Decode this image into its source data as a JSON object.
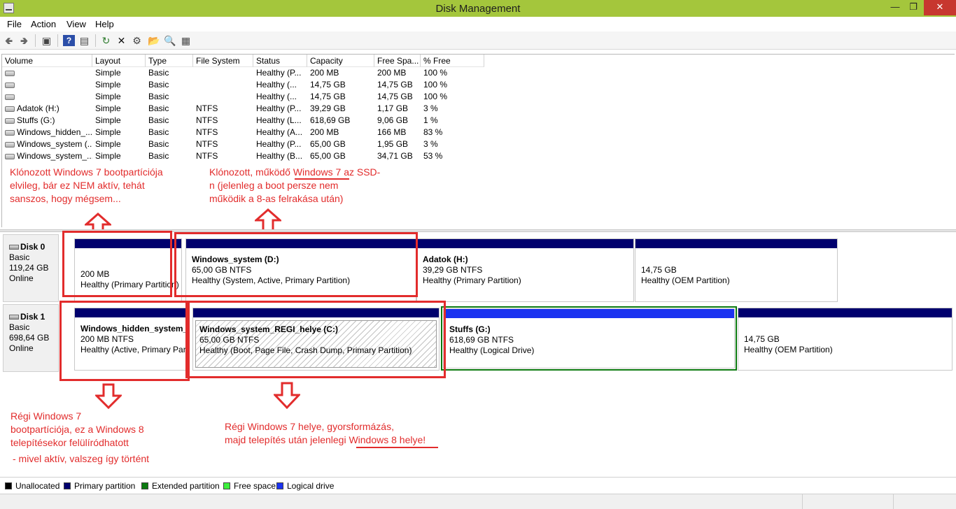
{
  "window": {
    "title": "Disk Management"
  },
  "menu": [
    "File",
    "Action",
    "View",
    "Help"
  ],
  "toolbar": {
    "icons": [
      "back-icon",
      "forward-icon",
      "console-tree-icon",
      "help-icon",
      "properties-icon",
      "refresh-icon",
      "delete-icon",
      "settings-icon",
      "open-icon",
      "search-icon",
      "export-icon"
    ]
  },
  "volume_list": {
    "columns": [
      "Volume",
      "Layout",
      "Type",
      "File System",
      "Status",
      "Capacity",
      "Free Spa...",
      "% Free"
    ],
    "rows": [
      [
        "",
        "Simple",
        "Basic",
        "",
        "Healthy (P...",
        "200 MB",
        "200 MB",
        "100 %"
      ],
      [
        "",
        "Simple",
        "Basic",
        "",
        "Healthy (...",
        "14,75 GB",
        "14,75 GB",
        "100 %"
      ],
      [
        "",
        "Simple",
        "Basic",
        "",
        "Healthy (...",
        "14,75 GB",
        "14,75 GB",
        "100 %"
      ],
      [
        "Adatok (H:)",
        "Simple",
        "Basic",
        "NTFS",
        "Healthy (P...",
        "39,29 GB",
        "1,17 GB",
        "3 %"
      ],
      [
        "Stuffs (G:)",
        "Simple",
        "Basic",
        "NTFS",
        "Healthy (L...",
        "618,69 GB",
        "9,06 GB",
        "1 %"
      ],
      [
        "Windows_hidden_...",
        "Simple",
        "Basic",
        "NTFS",
        "Healthy (A...",
        "200 MB",
        "166 MB",
        "83 %"
      ],
      [
        "Windows_system (...",
        "Simple",
        "Basic",
        "NTFS",
        "Healthy (P...",
        "65,00 GB",
        "1,95 GB",
        "3 %"
      ],
      [
        "Windows_system_...",
        "Simple",
        "Basic",
        "NTFS",
        "Healthy (B...",
        "65,00 GB",
        "34,71 GB",
        "53 %"
      ]
    ]
  },
  "disks": [
    {
      "name": "Disk 0",
      "type": "Basic",
      "size": "119,24 GB",
      "status": "Online",
      "partitions": [
        {
          "name": "",
          "size": "200 MB",
          "status": "Healthy (Primary Partition)"
        },
        {
          "name": "Windows_system  (D:)",
          "size": "65,00 GB NTFS",
          "status": "Healthy (System, Active, Primary Partition)"
        },
        {
          "name": "Adatok  (H:)",
          "size": "39,29 GB NTFS",
          "status": "Healthy (Primary Partition)"
        },
        {
          "name": "",
          "size": "14,75 GB",
          "status": "Healthy (OEM Partition)"
        }
      ]
    },
    {
      "name": "Disk 1",
      "type": "Basic",
      "size": "698,64 GB",
      "status": "Online",
      "partitions": [
        {
          "name": "Windows_hidden_system_p",
          "size": "200 MB NTFS",
          "status": "Healthy (Active, Primary Part"
        },
        {
          "name": "Windows_system_REGI_helye  (C:)",
          "size": "65,00 GB NTFS",
          "status": "Healthy (Boot, Page File, Crash Dump, Primary Partition)"
        },
        {
          "name": "Stuffs  (G:)",
          "size": "618,69 GB NTFS",
          "status": "Healthy (Logical Drive)"
        },
        {
          "name": "",
          "size": "14,75 GB",
          "status": "Healthy (OEM Partition)"
        }
      ]
    }
  ],
  "annotations": {
    "top_left": [
      "Klónozott Windows 7 bootpartíciója",
      "elvileg, bár ez NEM aktív, tehát",
      "sanszos, hogy mégsem..."
    ],
    "top_mid": [
      "Klónozott, működő Windows 7 az SSD-",
      "n (jelenleg a boot persze nem",
      "működik a 8-as felrakása után)"
    ],
    "bottom_left": [
      "Régi  Windows 7",
      "bootpartíciója, ez a Windows 8",
      "telepítésekor felülíródhatott"
    ],
    "bottom_left_note": "- mivel aktív, valszeg így történt",
    "bottom_mid": [
      "Régi  Windows 7 helye, gyorsformázás,",
      "majd telepítés után jelenlegi Windows 8 helye!"
    ]
  },
  "legend": [
    {
      "label": "Unallocated",
      "color": "#000000"
    },
    {
      "label": "Primary partition",
      "color": "#00006e"
    },
    {
      "label": "Extended partition",
      "color": "#0b7a10"
    },
    {
      "label": "Free space",
      "color": "#3cf03c"
    },
    {
      "label": "Logical drive",
      "color": "#1b33f0"
    }
  ],
  "colors": {
    "annotation": "#e22c2c",
    "titlebar": "#a4c63c"
  }
}
